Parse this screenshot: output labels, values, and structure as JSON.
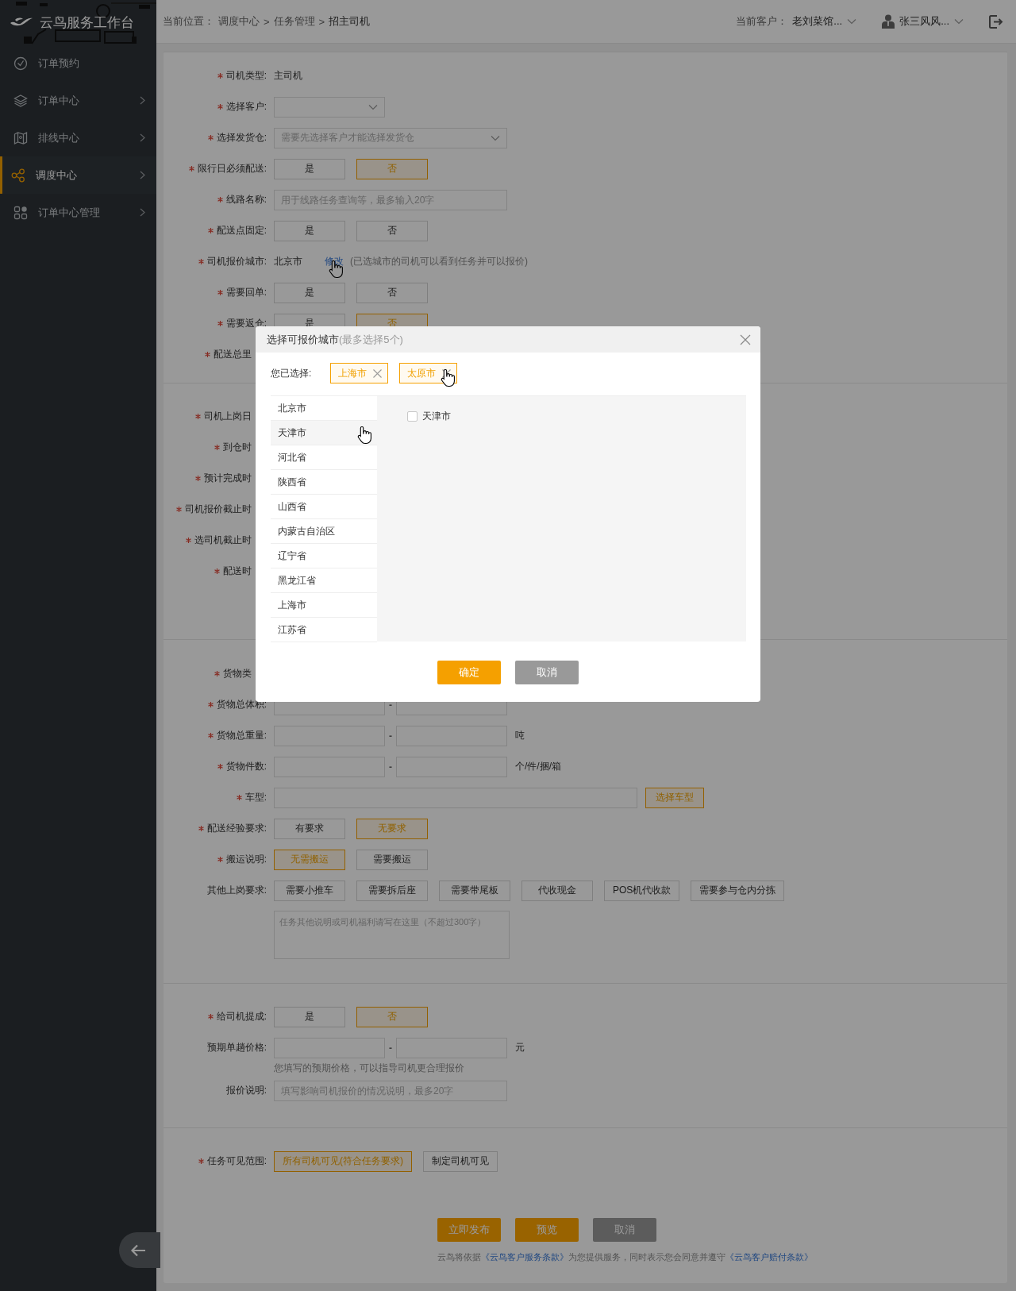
{
  "sidebar": {
    "brand": "云鸟服务工作台",
    "items": [
      {
        "label": "订单预约",
        "expandable": false,
        "selected": false
      },
      {
        "label": "订单中心",
        "expandable": true,
        "selected": false
      },
      {
        "label": "排线中心",
        "expandable": true,
        "selected": false
      },
      {
        "label": "调度中心",
        "expandable": true,
        "selected": true
      },
      {
        "label": "订单中心管理",
        "expandable": true,
        "selected": false
      }
    ]
  },
  "header": {
    "breadcrumb_label": "当前位置：",
    "breadcrumb": [
      {
        "text": "调度中心",
        "kind": "link"
      },
      {
        "text": ">",
        "kind": "separator"
      },
      {
        "text": "任务管理",
        "kind": "link"
      },
      {
        "text": ">",
        "kind": "separator"
      },
      {
        "text": "招主司机",
        "kind": "current"
      }
    ],
    "customer": {
      "label": "当前客户：",
      "value": "老刘菜馆..."
    },
    "user": {
      "name": "张三风风..."
    }
  },
  "form": {
    "sections": [
      {
        "rows": [
          {
            "kind": "text",
            "label": "司机类型:",
            "required": true,
            "value": "主司机"
          },
          {
            "kind": "picker",
            "label": "选择客户:",
            "required": true
          },
          {
            "kind": "select",
            "label": "选择发货仓:",
            "required": true,
            "placeholder": "需要先选择客户才能选择发货仓"
          },
          {
            "kind": "choice",
            "label": "限行日必须配送:",
            "required": true,
            "options": [
              {
                "label": "是",
                "selected": false
              },
              {
                "label": "否",
                "selected": true
              }
            ]
          },
          {
            "kind": "input",
            "label": "线路名称:",
            "required": true,
            "placeholder": "用于线路任务查询等，最多输入20字"
          },
          {
            "kind": "choice",
            "label": "配送点固定:",
            "required": true,
            "options": [
              {
                "label": "是",
                "selected": false
              },
              {
                "label": "否",
                "selected": false
              }
            ]
          },
          {
            "kind": "city",
            "label": "司机报价城市:",
            "required": true,
            "value": "北京市",
            "link": "修改",
            "hovered": true,
            "note": "(已选城市的司机可以看到任务并可以报价)"
          },
          {
            "kind": "choice",
            "label": "需要回单:",
            "required": true,
            "options": [
              {
                "label": "是",
                "selected": false
              },
              {
                "label": "否",
                "selected": false
              }
            ]
          },
          {
            "kind": "choice",
            "label": "需要返仓:",
            "required": true,
            "options": [
              {
                "label": "是",
                "selected": false
              },
              {
                "label": "否",
                "selected": true
              }
            ]
          },
          {
            "kind": "covered",
            "label": "配送总里",
            "required": true
          }
        ]
      },
      {
        "rows": [
          {
            "kind": "covered",
            "label": "司机上岗日",
            "required": true
          },
          {
            "kind": "covered",
            "label": "到仓时",
            "required": true
          },
          {
            "kind": "covered",
            "label": "预计完成时",
            "required": true
          },
          {
            "kind": "covered",
            "label": "司机报价截止时",
            "required": true
          },
          {
            "kind": "covered",
            "label": "选司机截止时",
            "required": true
          },
          {
            "kind": "covered",
            "label": "配送时",
            "required": true
          }
        ]
      },
      {
        "rows": [
          {
            "kind": "covered",
            "label": "货物类",
            "required": true
          },
          {
            "kind": "range",
            "label": "货物总体积:",
            "required": true,
            "separator": "-"
          },
          {
            "kind": "range",
            "label": "货物总重量:",
            "required": true,
            "separator": "-",
            "unit": "吨"
          },
          {
            "kind": "range",
            "label": "货物件数:",
            "required": true,
            "separator": "-",
            "unit": "个/件/捆/箱"
          },
          {
            "kind": "vehicle",
            "label": "车型:",
            "required": true,
            "button": "选择车型"
          },
          {
            "kind": "choice",
            "label": "配送经验要求:",
            "required": true,
            "options": [
              {
                "label": "有要求",
                "selected": false
              },
              {
                "label": "无要求",
                "selected": true
              }
            ]
          },
          {
            "kind": "choice",
            "label": "搬运说明:",
            "required": true,
            "options": [
              {
                "label": "无需搬运",
                "selected": true
              },
              {
                "label": "需要搬运",
                "selected": false
              }
            ]
          },
          {
            "kind": "choice",
            "label": "其他上岗要求:",
            "required": false,
            "options": [
              {
                "label": "需要小推车",
                "selected": false
              },
              {
                "label": "需要拆后座",
                "selected": false
              },
              {
                "label": "需要带尾板",
                "selected": false
              },
              {
                "label": "代收现金",
                "selected": false
              },
              {
                "label": "POS机代收款",
                "selected": false
              },
              {
                "label": "需要参与仓内分拣",
                "selected": false
              }
            ]
          },
          {
            "kind": "textarea",
            "placeholder": "任务其他说明或司机福利请写在这里（不超过300字）"
          }
        ]
      },
      {
        "rows": [
          {
            "kind": "choice",
            "label": "给司机提成:",
            "required": true,
            "options": [
              {
                "label": "是",
                "selected": false
              },
              {
                "label": "否",
                "selected": true
              }
            ]
          },
          {
            "kind": "range",
            "label": "预期单趟价格:",
            "required": false,
            "separator": "-",
            "unit": "元"
          },
          {
            "kind": "hint",
            "text": "您填写的预期价格，可以指导司机更合理报价"
          },
          {
            "kind": "input",
            "label": "报价说明:",
            "required": false,
            "placeholder": "填写影响司机报价的情况说明，最多20字"
          }
        ]
      },
      {
        "rows": [
          {
            "kind": "choice",
            "label": "任务可见范围:",
            "required": true,
            "options": [
              {
                "label": "所有司机可见(符合任务要求)",
                "selected": true
              },
              {
                "label": "制定司机可见",
                "selected": false
              }
            ]
          }
        ]
      }
    ],
    "actions": {
      "buttons": [
        {
          "label": "立即发布",
          "kind": "primary"
        },
        {
          "label": "预览",
          "kind": "primary"
        },
        {
          "label": "取消",
          "kind": "disabled"
        }
      ],
      "terms": [
        {
          "text": "云鸟将依据",
          "kind": "plain"
        },
        {
          "text": "《云鸟客户服务条款》",
          "kind": "link"
        },
        {
          "text": "为您提供服务，同时表示您会同意并遵守",
          "kind": "plain"
        },
        {
          "text": "《云鸟客户赔付条款》",
          "kind": "link"
        }
      ]
    }
  },
  "modal": {
    "title": "选择可报价城市",
    "subtitle": "(最多选择5个)",
    "selected_label": "您已选择:",
    "chips": [
      {
        "label": "上海市",
        "hovered": false
      },
      {
        "label": "太原市",
        "hovered": true
      }
    ],
    "provinces": [
      {
        "label": "北京市",
        "selected": false
      },
      {
        "label": "天津市",
        "selected": true
      },
      {
        "label": "河北省",
        "selected": false
      },
      {
        "label": "陕西省",
        "selected": false
      },
      {
        "label": "山西省",
        "selected": false
      },
      {
        "label": "内蒙古自治区",
        "selected": false
      },
      {
        "label": "辽宁省",
        "selected": false
      },
      {
        "label": "黑龙江省",
        "selected": false
      },
      {
        "label": "上海市",
        "selected": false
      },
      {
        "label": "江苏省",
        "selected": false
      }
    ],
    "cities": [
      {
        "label": "天津市",
        "checked": false
      }
    ],
    "buttons": [
      {
        "label": "确定",
        "kind": "primary"
      },
      {
        "label": "取消",
        "kind": "secondary"
      }
    ]
  }
}
